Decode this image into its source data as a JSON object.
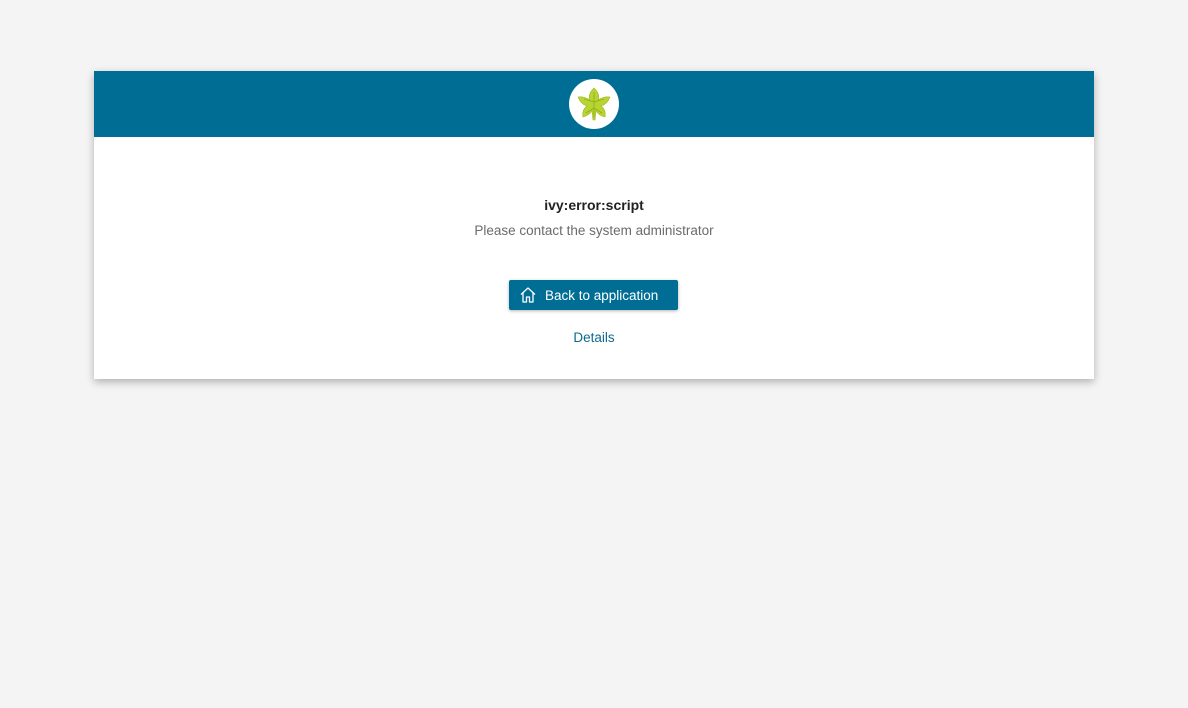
{
  "error": {
    "title": "ivy:error:script",
    "message": "Please contact the system administrator"
  },
  "actions": {
    "back_label": "Back to application",
    "back_icon": "home-icon",
    "details_label": "Details"
  },
  "logo": {
    "icon": "ivy-leaf-icon"
  },
  "colors": {
    "brand": "#006e94",
    "background": "#f4f4f4",
    "leaf": "#b8d432"
  }
}
